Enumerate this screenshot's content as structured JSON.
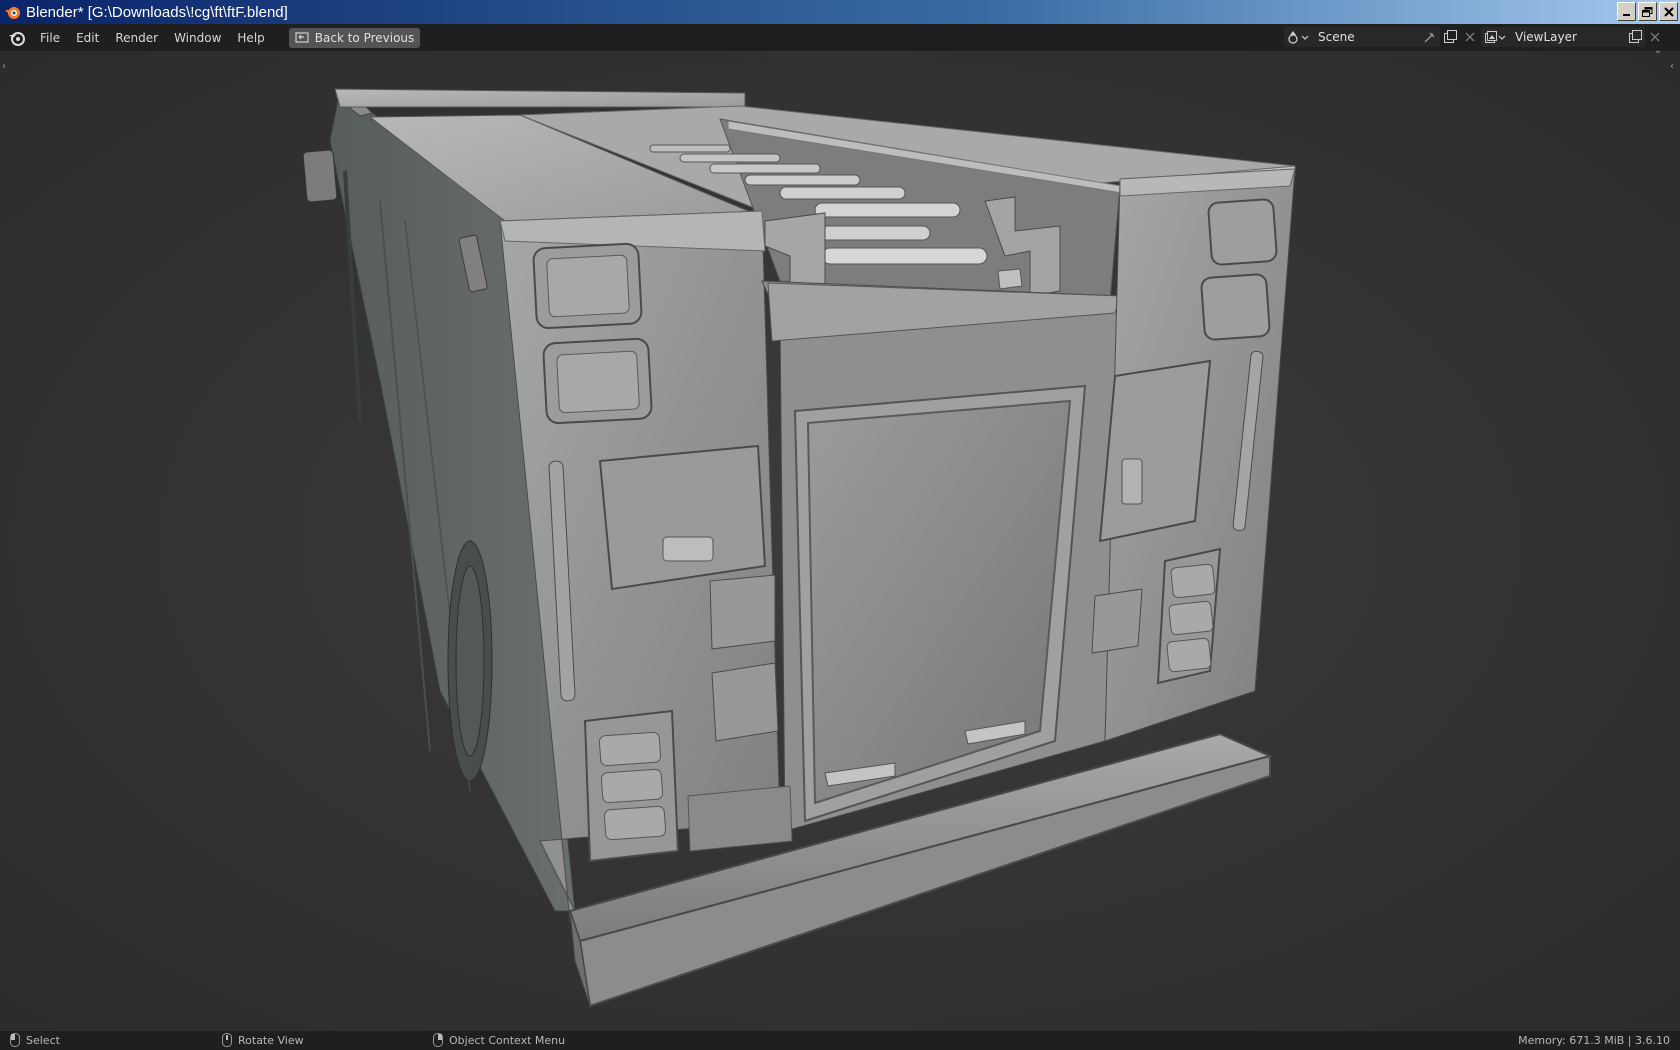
{
  "titlebar": {
    "title": "Blender* [G:\\Downloads\\!cg\\ft\\ftF.blend]"
  },
  "menu": {
    "items": [
      "File",
      "Edit",
      "Render",
      "Window",
      "Help"
    ],
    "back_button": "Back to Previous"
  },
  "scene_selector": {
    "value": "Scene"
  },
  "viewlayer_selector": {
    "value": "ViewLayer"
  },
  "statusbar": {
    "select": "Select",
    "rotate_view": "Rotate View",
    "context_menu": "Object Context Menu",
    "memory": "Memory: 671.3 MiB | 3.6.10"
  },
  "icons": {
    "app": "blender-icon",
    "scene": "scene-icon",
    "viewlayer": "viewlayer-icon",
    "pin": "pin-icon",
    "new": "new-icon",
    "close": "close-icon",
    "mouse": "mouse-icon"
  },
  "colors": {
    "titlebar_start": "#0a246a",
    "titlebar_end": "#a6caf0",
    "topbar": "#1f1f1f",
    "viewport": "#333333",
    "model": "#8f8f8f"
  }
}
